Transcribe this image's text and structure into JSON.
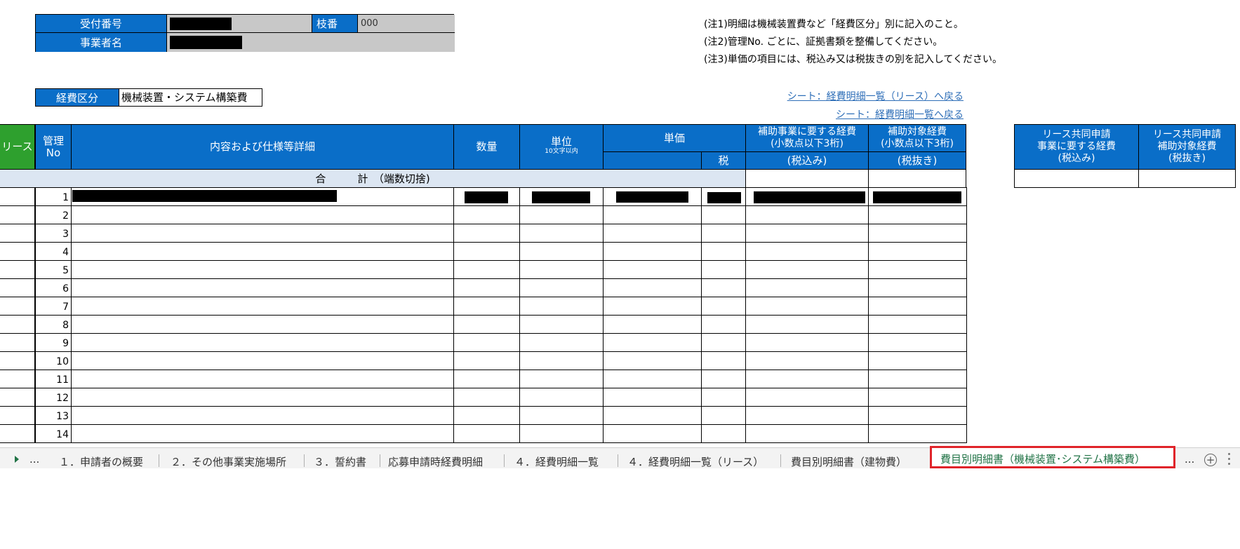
{
  "header": {
    "reception_label": "受付番号",
    "branch_label": "枝番",
    "branch_value": "000",
    "business_label": "事業者名"
  },
  "notes": [
    "(注1)明細は機械装置費など「経費区分」別に記入のこと。",
    "(注2)管理No. ごとに、証拠書類を整備してください。",
    "(注3)単価の項目には、税込み又は税抜きの別を記入してください。"
  ],
  "expense": {
    "label": "経費区分",
    "value": "機械装置・システム構築費"
  },
  "links": {
    "back_lease": "シート：経費明細一覧（リース）へ戻る",
    "back_list": "シート：経費明細一覧へ戻る"
  },
  "table": {
    "col_lease": "リース",
    "col_mgmt": "管理\nNo",
    "col_detail": "内容および仕様等詳細",
    "col_qty": "数量",
    "col_unit": "単位",
    "col_unit_note": "10文字以内",
    "col_price": "単価",
    "col_tax": "税",
    "col_total_a": "補助事業に要する経費\n(小数点以下3桁)",
    "col_total_a_sub": "(税込み)",
    "col_total_b": "補助対象経費\n(小数点以下3桁)",
    "col_total_b_sub": "(税抜き)",
    "sum_label": "合　　　計　（端数切捨)",
    "rows": [
      "1",
      "2",
      "3",
      "4",
      "5",
      "6",
      "7",
      "8",
      "9",
      "10",
      "11",
      "12",
      "13",
      "14"
    ]
  },
  "side_table": {
    "col_a": "リース共同申請\n事業に要する経費\n(税込み)",
    "col_b": "リース共同申請\n補助対象経費\n(税抜き)"
  },
  "tabs": {
    "ellipsis": "...",
    "items": [
      "１．申請者の概要",
      "２．その他事業実施場所",
      "３．誓約書",
      "応募申請時経費明細",
      "４．経費明細一覧",
      "４．経費明細一覧（リース）",
      "費目別明細書（建物費）",
      "費目別明細書（機械装置･システム構築費）"
    ],
    "more": "..."
  },
  "colors": {
    "header_blue": "#0a6ec8",
    "lease_green": "#2ea02e",
    "active_tab": "#217346",
    "highlight": "#e0242a"
  }
}
